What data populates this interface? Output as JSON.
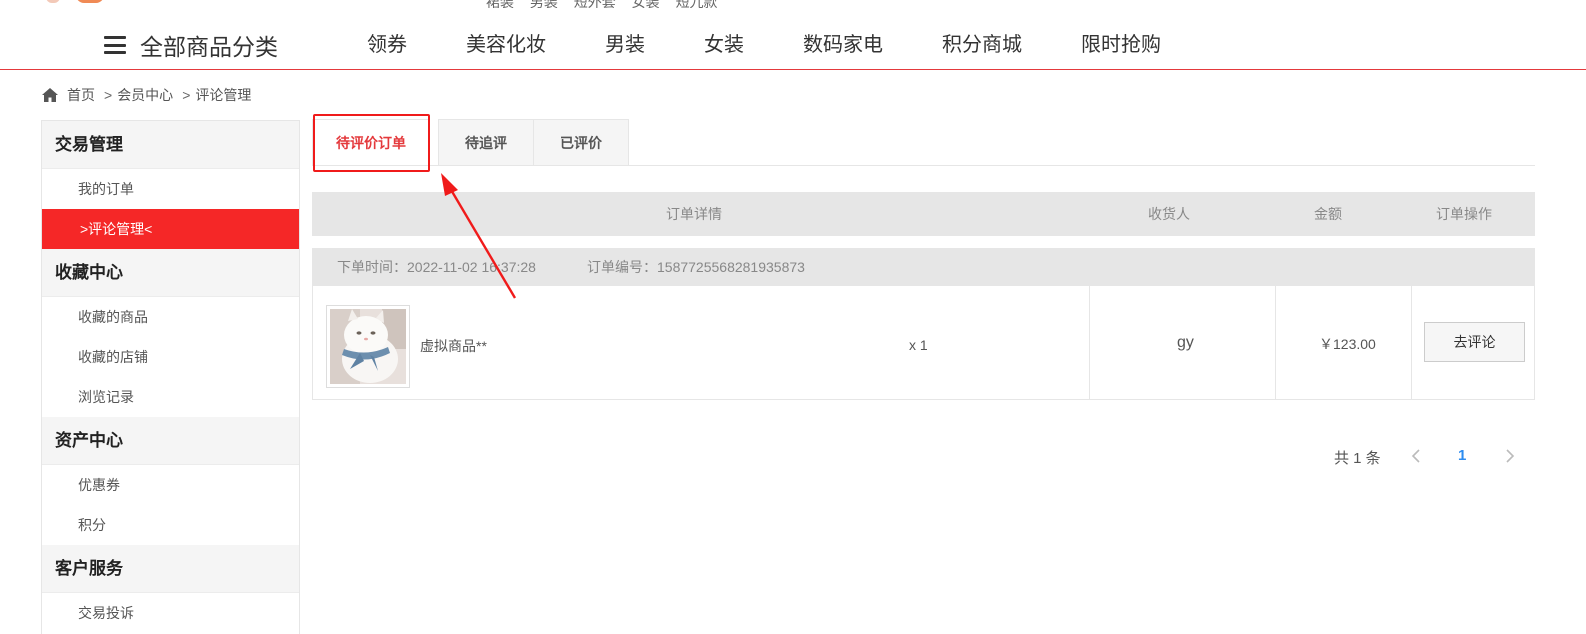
{
  "top": {
    "hot_words": [
      "裙装",
      "男装",
      "短外套",
      "女装",
      "短九款"
    ]
  },
  "nav": {
    "all_categories": "全部商品分类",
    "items": [
      "领券",
      "美容化妆",
      "男装",
      "女装",
      "数码家电",
      "积分商城",
      "限时抢购"
    ]
  },
  "breadcrumb": {
    "home": "首页",
    "sep": ">",
    "level1": "会员中心",
    "level2": "评论管理"
  },
  "sidebar": {
    "groups": [
      {
        "title": "交易管理",
        "items": [
          "我的订单",
          ">评论管理<"
        ]
      },
      {
        "title": "收藏中心",
        "items": [
          "收藏的商品",
          "收藏的店铺",
          "浏览记录"
        ]
      },
      {
        "title": "资产中心",
        "items": [
          "优惠券",
          "积分"
        ]
      },
      {
        "title": "客户服务",
        "items": [
          "交易投诉"
        ]
      }
    ]
  },
  "tabs": [
    "待评价订单",
    "待追评",
    "已评价"
  ],
  "table": {
    "headers": [
      "订单详情",
      "收货人",
      "金额",
      "订单操作"
    ]
  },
  "order": {
    "time_label": "下单时间：2022-11-02 16:37:28",
    "number_label": "订单编号：1587725568281935873",
    "product_name": "虚拟商品**",
    "quantity": "x 1",
    "receiver": "gy",
    "amount": "￥123.00",
    "action": "去评论"
  },
  "pagination": {
    "total": "共 1 条",
    "current_page": "1"
  },
  "colors": {
    "accent": "#e4393c",
    "active_sidebar": "#f52727",
    "annotation": "#f01b1b",
    "page_link": "#2d8cf0"
  }
}
